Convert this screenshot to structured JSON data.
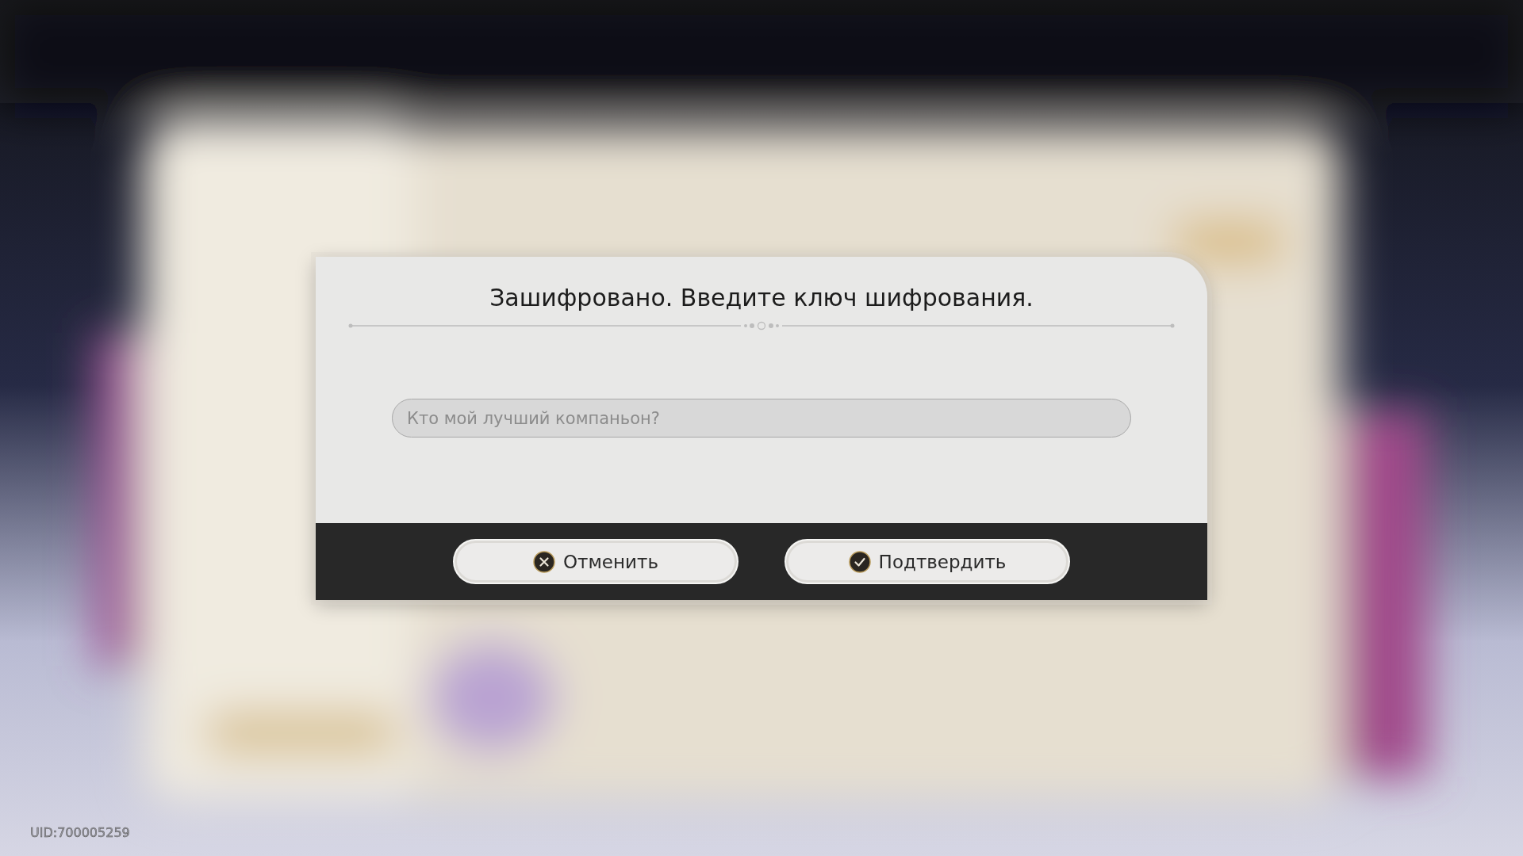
{
  "dialog": {
    "title": "Зашифровано. Введите ключ шифрования.",
    "input": {
      "placeholder": "Кто мой лучший компаньон?"
    },
    "buttons": [
      {
        "kind": "cancel",
        "label": "Отменить"
      },
      {
        "kind": "confirm",
        "label": "Подтвердить"
      }
    ]
  },
  "uid": "UID:700005259"
}
